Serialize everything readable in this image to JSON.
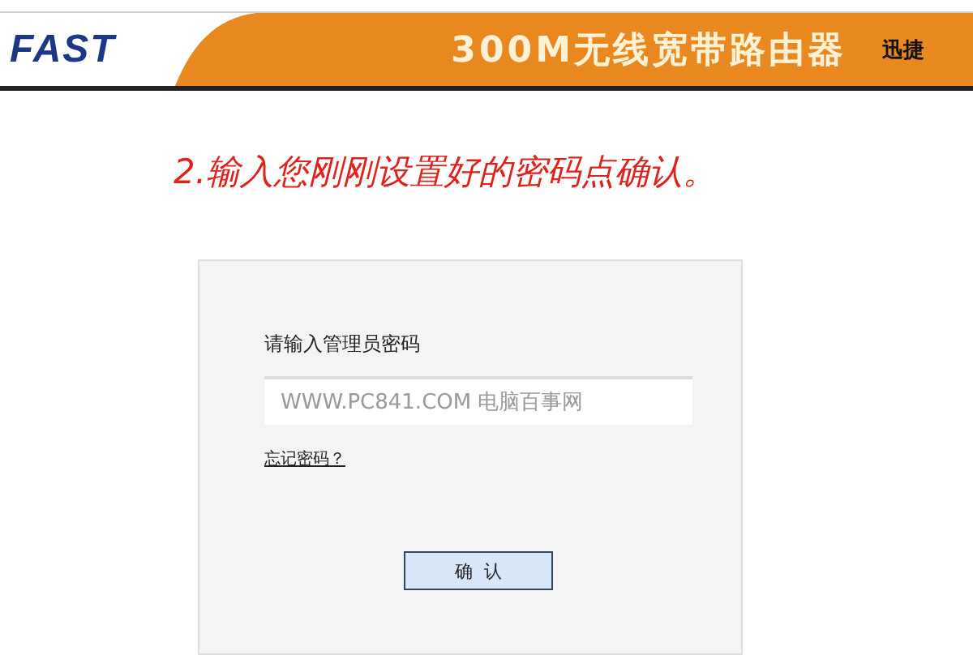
{
  "header": {
    "logo": "FAST",
    "title": "300M无线宽带路由器",
    "brand": "迅捷"
  },
  "instruction": "2.输入您刚刚设置好的密码点确认。",
  "login": {
    "label": "请输入管理员密码",
    "password": {
      "placeholder": "WWW.PC841.COM 电脑百事网"
    },
    "forgot_link": "忘记密码？",
    "confirm_button": "确  认"
  }
}
